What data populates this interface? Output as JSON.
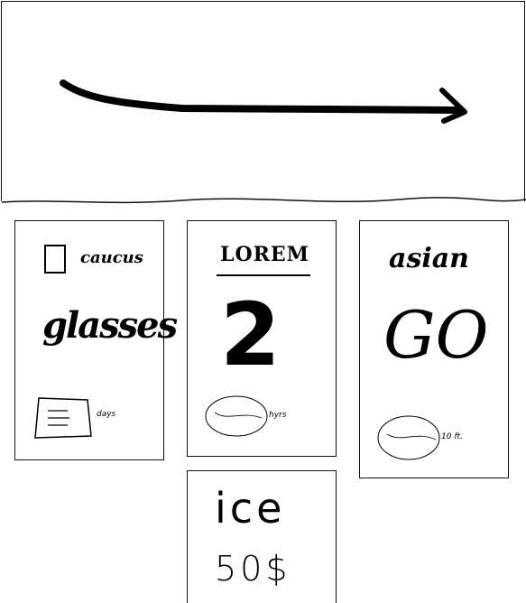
{
  "top_banner": {
    "arrow_icon": "right-arrow-icon"
  },
  "cards": [
    {
      "checkbox_icon": "checkbox-icon",
      "caption": "caucus",
      "title": "glasses",
      "footer_icon": "note-card-icon",
      "footer_text": "days"
    },
    {
      "header": "LOREM",
      "value": "2",
      "footer_icon": "oval-sketch-icon",
      "footer_text": "hyrs"
    },
    {
      "header": "asian",
      "value": "GO",
      "footer_icon": "oval-sketch-icon",
      "footer_text": "10 ft."
    },
    {
      "header": "ice",
      "value": "50$"
    }
  ]
}
